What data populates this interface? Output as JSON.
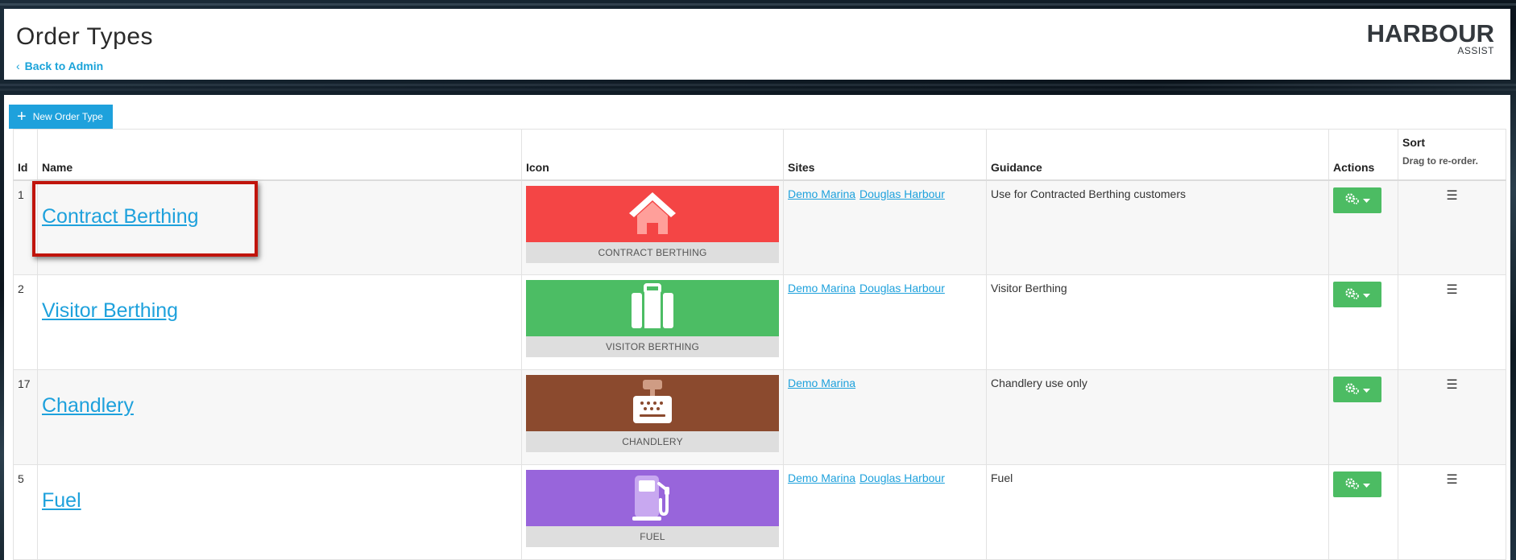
{
  "header": {
    "title": "Order Types",
    "back_label": "Back to Admin",
    "logo_main": "HARBOUR",
    "logo_sub": "ASSIST"
  },
  "toolbar": {
    "new_label": "New Order Type"
  },
  "table": {
    "columns": {
      "id": "Id",
      "name": "Name",
      "icon": "Icon",
      "sites": "Sites",
      "guidance": "Guidance",
      "actions": "Actions",
      "sort": "Sort",
      "sort_sub": "Drag to re-order."
    },
    "rows": [
      {
        "id": "1",
        "name": "Contract Berthing",
        "icon_name": "house-icon",
        "icon_color": "#f44545",
        "icon_label": "CONTRACT BERTHING",
        "sites": [
          "Demo Marina",
          "Douglas Harbour"
        ],
        "guidance": "Use for Contracted Berthing customers"
      },
      {
        "id": "2",
        "name": "Visitor Berthing",
        "icon_name": "suitcase-icon",
        "icon_color": "#4cbd64",
        "icon_label": "VISITOR BERTHING",
        "sites": [
          "Demo Marina",
          "Douglas Harbour"
        ],
        "guidance": "Visitor Berthing"
      },
      {
        "id": "17",
        "name": "Chandlery",
        "icon_name": "cash-register-icon",
        "icon_color": "#8b4a2e",
        "icon_label": "CHANDLERY",
        "sites": [
          "Demo Marina"
        ],
        "guidance": "Chandlery use only"
      },
      {
        "id": "5",
        "name": "Fuel",
        "icon_name": "gas-pump-icon",
        "icon_color": "#9865db",
        "icon_label": "FUEL",
        "sites": [
          "Demo Marina",
          "Douglas Harbour"
        ],
        "guidance": "Fuel"
      }
    ]
  },
  "colors": {
    "accent": "#1ea1dc",
    "action_green": "#4cbc63",
    "highlight": "#c0140c"
  },
  "drag_glyph": "☰"
}
